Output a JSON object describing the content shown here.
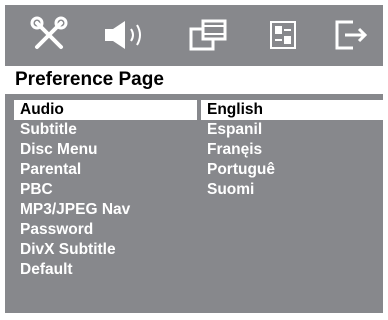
{
  "header": {
    "title": "Preference Page"
  },
  "tabs": [
    {
      "icon": "settings-tools-icon"
    },
    {
      "icon": "speaker-icon"
    },
    {
      "icon": "video-film-icon"
    },
    {
      "icon": "preference-sliders-icon"
    },
    {
      "icon": "exit-icon"
    }
  ],
  "menu": {
    "items": [
      "Audio",
      "Subtitle",
      "Disc Menu",
      "Parental",
      "PBC",
      "MP3/JPEG Nav",
      "Password",
      "DivX Subtitle",
      "Default"
    ],
    "selected_index": 0
  },
  "options": {
    "items": [
      "English",
      "Espanil",
      "Franęis",
      "Portuguê",
      "Suomi"
    ],
    "selected_index": 0
  },
  "colors": {
    "panel": "#87888c",
    "highlight": "#ffffff",
    "text": "#ffffff",
    "selected_text": "#000000"
  }
}
